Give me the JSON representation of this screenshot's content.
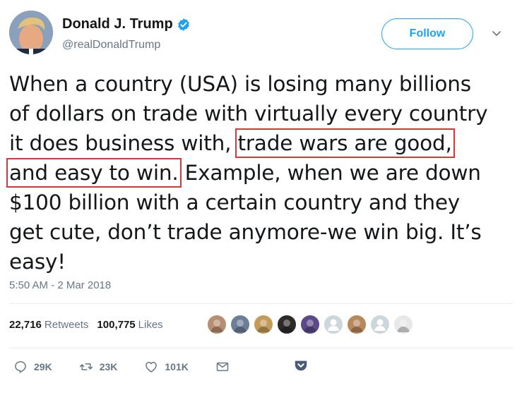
{
  "user": {
    "display_name": "Donald J. Trump",
    "handle": "@realDonaldTrump",
    "verified": true
  },
  "header": {
    "follow_label": "Follow"
  },
  "tweet": {
    "lines": [
      {
        "pre": "When a country (USA) is losing many billions",
        "hl": "",
        "post": ""
      },
      {
        "pre": "of dollars on trade with virtually every country",
        "hl": "",
        "post": ""
      },
      {
        "pre": "it does business with, ",
        "hl": "trade wars are good,",
        "post": ""
      },
      {
        "pre": "",
        "hl": "and easy to win.",
        "post": " Example, when we are down"
      },
      {
        "pre": "$100 billion with a certain country and they",
        "hl": "",
        "post": ""
      },
      {
        "pre": "get cute, don’t trade anymore-we win big. It’s",
        "hl": "",
        "post": ""
      },
      {
        "pre": "easy!",
        "hl": "",
        "post": ""
      }
    ],
    "highlight_color": "#d9383a",
    "timestamp": "5:50 AM - 2 Mar 2018"
  },
  "stats": {
    "retweets_count": "22,716",
    "retweets_label": "Retweets",
    "likes_count": "100,775",
    "likes_label": "Likes"
  },
  "likers": [
    {
      "icon": "user-avatar",
      "color": "#b88e72"
    },
    {
      "icon": "user-avatar",
      "color": "#6d7f98"
    },
    {
      "icon": "user-avatar",
      "color": "#c59b5a"
    },
    {
      "icon": "user-avatar",
      "color": "#2e2a2a"
    },
    {
      "icon": "user-avatar",
      "color": "#5a4a8a"
    },
    {
      "icon": "default-avatar",
      "color": "#ccd6dd"
    },
    {
      "icon": "user-avatar",
      "color": "#b9895e"
    },
    {
      "icon": "default-avatar",
      "color": "#ccd6dd"
    },
    {
      "icon": "user-avatar",
      "color": "#e8e8e8"
    }
  ],
  "actions": {
    "reply_count": "29K",
    "retweet_count": "23K",
    "like_count": "101K"
  },
  "colors": {
    "brand_blue": "#1da1f2",
    "secondary_text": "#657786"
  }
}
